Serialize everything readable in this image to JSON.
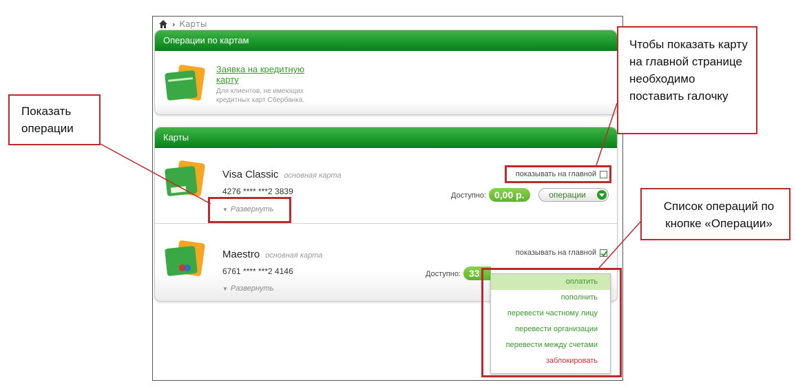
{
  "breadcrumb": {
    "current": "Карты"
  },
  "operations_panel": {
    "title": "Операции по картам",
    "link": "Заявка на кредитную карту",
    "description": "Для клиентов, не имеющих кредитных карт Сбербанка."
  },
  "cards_panel": {
    "title": "Карты",
    "cards": [
      {
        "name": "Visa Classic",
        "type": "основная карта",
        "number": "4276 **** ***2 3839",
        "expand": "Развернуть",
        "show_on_main": "показывать на главной",
        "show_on_main_checked": false,
        "available_label": "Доступно:",
        "balance": "0,00 р.",
        "operations_button": "операции"
      },
      {
        "name": "Maestro",
        "type": "основная карта",
        "number": "6761 **** ***2 4146",
        "expand": "Развернуть",
        "show_on_main": "показывать на главной",
        "show_on_main_checked": true,
        "available_label": "Доступно:",
        "balance": "33 5"
      }
    ]
  },
  "operations_menu": {
    "items": [
      "оплатить",
      "пополнить",
      "перевести частному лицу",
      "перевести организации",
      "перевести между счетами",
      "заблокировать"
    ]
  },
  "annotations": {
    "show_operations": "Показать операции",
    "checkbox_note": "Чтобы показать карту на главной странице необходимо поставить галочку",
    "operations_list": "Список операций по кнопке «Операции»"
  },
  "colors": {
    "green": "#1c9a2a",
    "accent_red": "#c0282c",
    "link_green": "#3a9a2b"
  }
}
